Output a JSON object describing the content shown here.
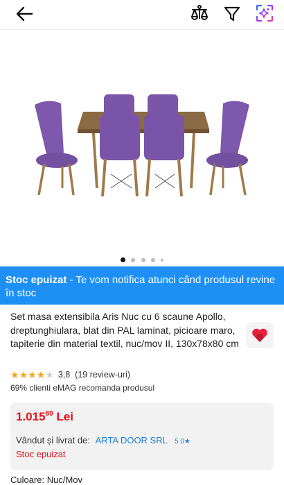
{
  "toolbar": {
    "back_icon": "arrow-left-icon",
    "compare_icon": "compare-scale-icon",
    "filter_icon": "filter-funnel-icon",
    "ai_icon": "ai-sparkle-icon"
  },
  "gallery": {
    "image_alt": "purple-chairs-table-icon",
    "dots_count": 5,
    "active_index": 0
  },
  "banner": {
    "status": "Stoc epuizat",
    "message": " - Te vom notifica atunci când produsul revine în stoc",
    "color": "#1e90f5"
  },
  "product": {
    "title": "Set masa extensibila Aris Nuc cu 6 scaune Apollo, dreptunghiulara, blat din PAL laminat, picioare maro, tapiterie din material textil, nuc/mov II, 130x78x80 cm",
    "favorite_icon": "heart-icon",
    "rating_value": "3,8",
    "rating_fraction": 0.76,
    "reviews": "(19 review-uri)",
    "recommend": "69% clienti eMAG recomanda produsul"
  },
  "pricing": {
    "price_int": "1.015",
    "price_dec": "80",
    "currency": "Lei",
    "vendor_label": "Vândut și livrat de:",
    "vendor_name": "ARTA DOOR SRL",
    "vendor_score": "5.0",
    "stock": "Stoc epuizat",
    "accent": "#e3101a"
  },
  "variant": {
    "color_label": "Culoare: Nuc/Mov"
  }
}
